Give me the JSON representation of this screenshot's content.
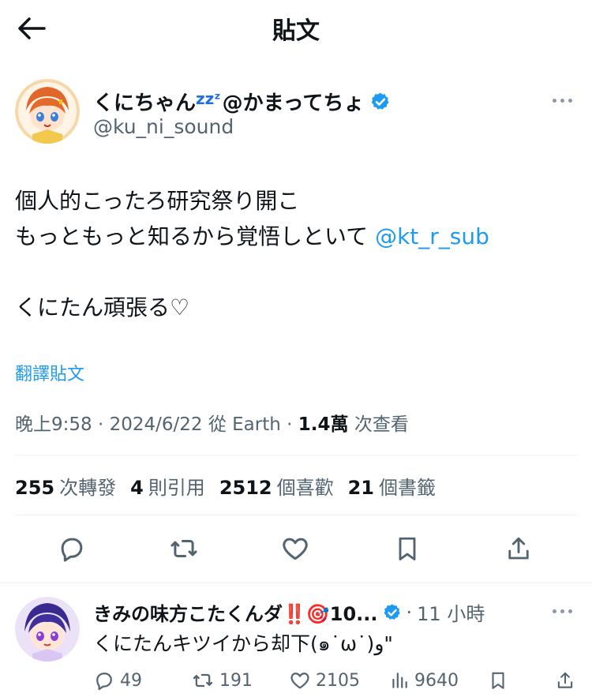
{
  "header": {
    "title": "貼文"
  },
  "tweet": {
    "author_name": "くにちゃん",
    "author_name_zz": "zzᶻ",
    "author_name_suffix": "@かまってちょ",
    "author_handle": "@ku_ni_sound",
    "body_line1": "個人的こったろ研究祭り開こ",
    "body_line2": "もっともっと知るから覚悟しといて ",
    "body_mention": "@kt_r_sub",
    "body_line3": "くにたん頑張る♡",
    "translate": "翻譯貼文",
    "time": "晚上9:58",
    "date": "2024/6/22",
    "source": "從 Earth",
    "views_count": "1.4萬",
    "views_label": "次查看",
    "stats": {
      "retweets_count": "255",
      "retweets_label": "次轉發",
      "quotes_count": "4",
      "quotes_label": "則引用",
      "likes_count": "2512",
      "likes_label": "個喜歡",
      "bookmarks_count": "21",
      "bookmarks_label": "個書籤"
    }
  },
  "reply": {
    "author_name": "きみの味方こたくんダ‼️🎯10...",
    "time": "11 小時",
    "text": "くにたんキツイから却下(๑˙ω˙)و\"",
    "replies": "49",
    "retweets": "191",
    "likes": "2105",
    "views": "9640"
  },
  "colors": {
    "accent": "#1d9bf0",
    "muted": "#536471",
    "divider": "#eff3f4"
  }
}
